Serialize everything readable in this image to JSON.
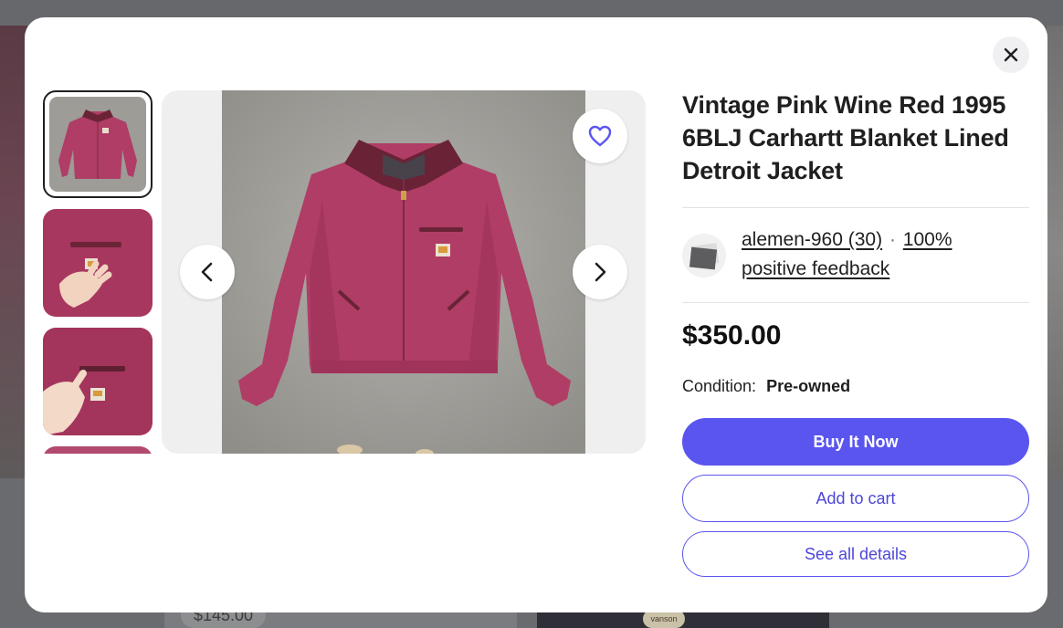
{
  "background": {
    "price_label": "$145.00",
    "tag_label": "vanson"
  },
  "modal": {
    "close_icon": "close-icon",
    "gallery": {
      "thumbnail_count_visible": 4,
      "selected_index": 0,
      "prev_icon": "chevron-left-icon",
      "next_icon": "chevron-right-icon",
      "favorite_icon": "heart-icon"
    },
    "listing": {
      "title": "Vintage Pink Wine Red 1995 6BLJ Carhartt Blanket Lined Detroit Jacket",
      "seller": {
        "name_with_count": "alemen-960 (30)",
        "separator": "·",
        "feedback": "100% positive feedback"
      },
      "price": "$350.00",
      "condition_label": "Condition:",
      "condition_value": "Pre-owned"
    },
    "actions": {
      "buy_now": "Buy It Now",
      "add_to_cart": "Add to cart",
      "see_details": "See all details"
    }
  },
  "colors": {
    "accent": "#5a55ef",
    "jacket": "#b03d66"
  }
}
